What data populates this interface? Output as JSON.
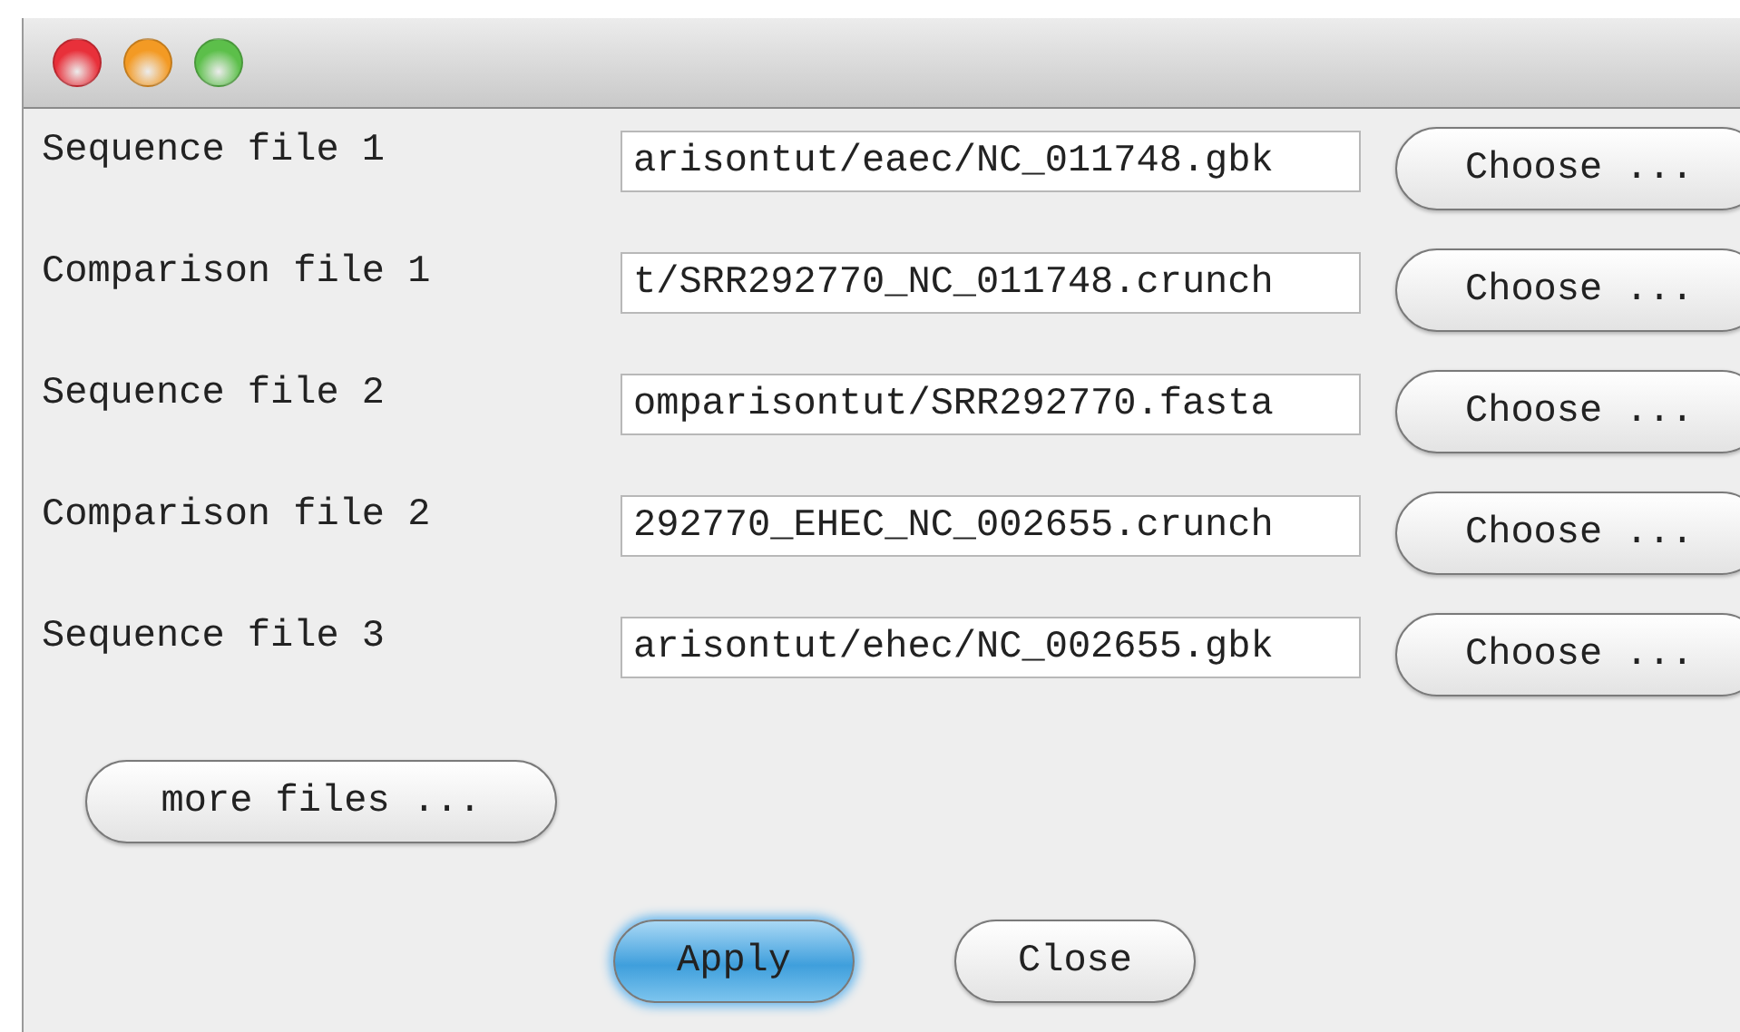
{
  "rows": [
    {
      "label": "Sequence file 1",
      "value": "arisontut/eaec/NC_011748.gbk",
      "button": "Choose ..."
    },
    {
      "label": "Comparison file 1",
      "value": "t/SRR292770_NC_011748.crunch",
      "button": "Choose ..."
    },
    {
      "label": "Sequence file 2",
      "value": "omparisontut/SRR292770.fasta",
      "button": "Choose ..."
    },
    {
      "label": "Comparison file 2",
      "value": "292770_EHEC_NC_002655.crunch",
      "button": "Choose ..."
    },
    {
      "label": "Sequence file 3",
      "value": "arisontut/ehec/NC_002655.gbk",
      "button": "Choose ..."
    }
  ],
  "more_button": "more files ...",
  "buttons": [
    {
      "label": "Apply",
      "default": true
    },
    {
      "label": "Close",
      "default": false
    }
  ]
}
